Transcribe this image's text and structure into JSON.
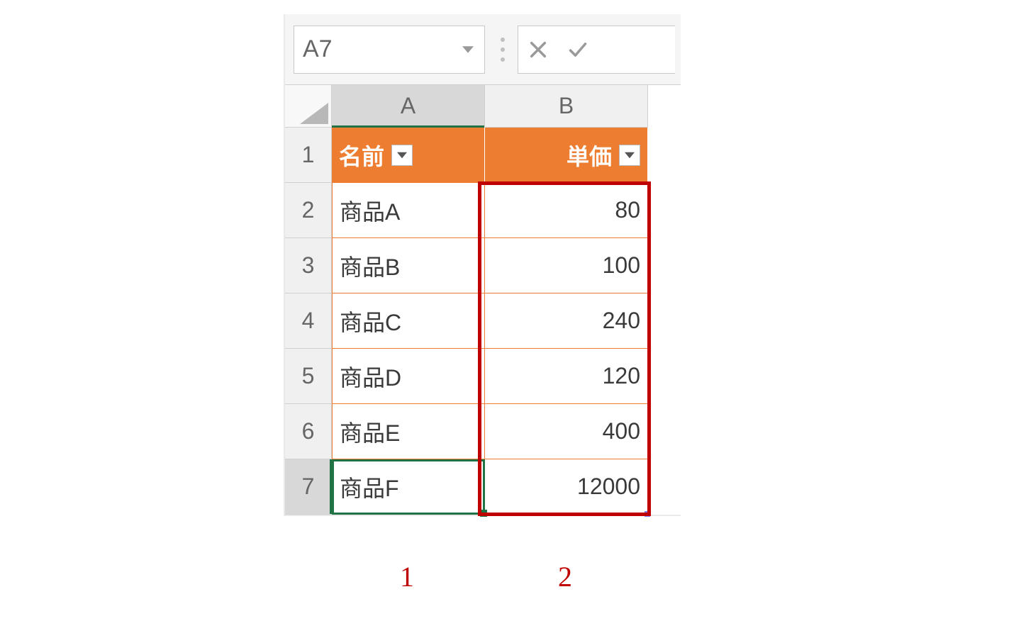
{
  "name_box": {
    "value": "A7"
  },
  "columns": [
    "A",
    "B"
  ],
  "row_numbers": [
    1,
    2,
    3,
    4,
    5,
    6,
    7
  ],
  "header_row": {
    "col_a": "名前",
    "col_b": "単価"
  },
  "rows": [
    {
      "name": "商品A",
      "price": "80"
    },
    {
      "name": "商品B",
      "price": "100"
    },
    {
      "name": "商品C",
      "price": "240"
    },
    {
      "name": "商品D",
      "price": "120"
    },
    {
      "name": "商品E",
      "price": "400"
    },
    {
      "name": "商品F",
      "price": "12000"
    }
  ],
  "selection": {
    "cell": "A7",
    "row": 7,
    "col": "A"
  },
  "annotations": {
    "label_1": "1",
    "label_2": "2"
  },
  "colors": {
    "table_header_fill": "#ed7d31",
    "selection_border": "#217346",
    "annotation": "#c00000"
  }
}
